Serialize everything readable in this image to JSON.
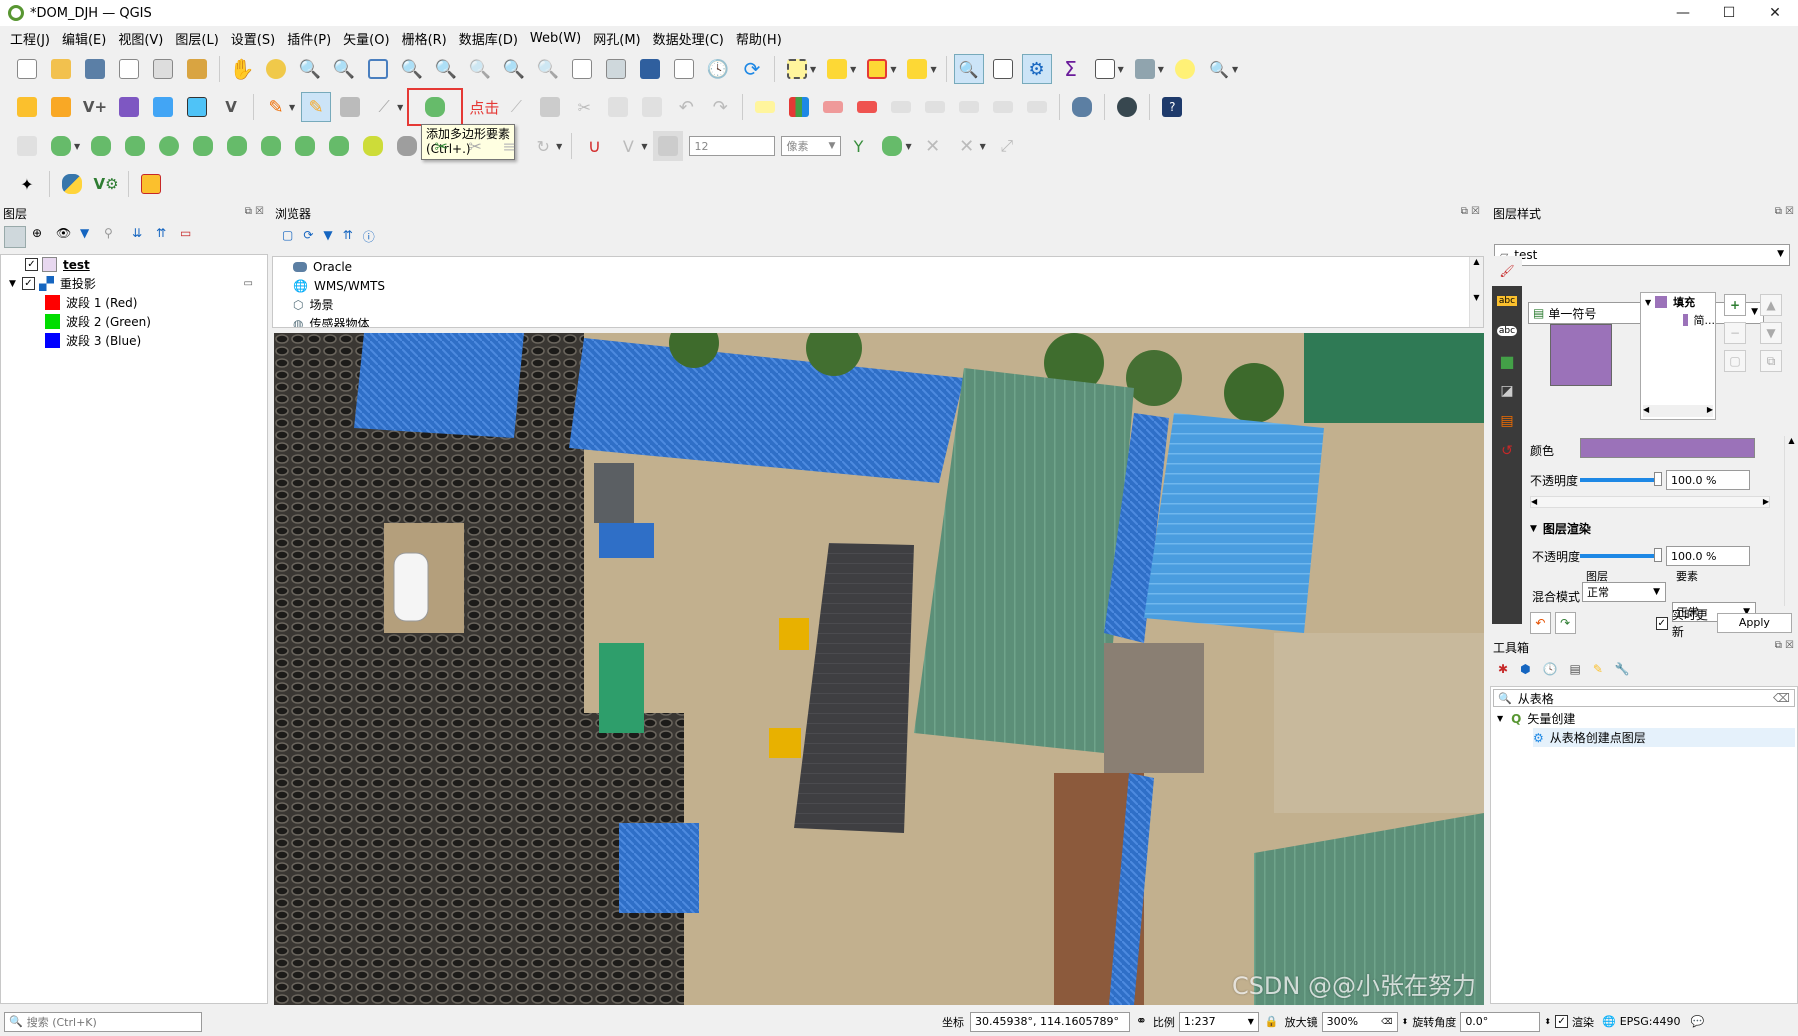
{
  "window": {
    "title": "*DOM_DJH — QGIS",
    "minimize": "—",
    "maximize": "☐",
    "close": "✕"
  },
  "menu": [
    "工程(J)",
    "编辑(E)",
    "视图(V)",
    "图层(L)",
    "设置(S)",
    "插件(P)",
    "矢量(O)",
    "栅格(R)",
    "数据库(D)",
    "Web(W)",
    "网孔(M)",
    "数据处理(C)",
    "帮助(H)"
  ],
  "digitize": {
    "click_annotation": "点击",
    "tooltip_line1": "添加多边形要素",
    "tooltip_line2": "(Ctrl+.)",
    "snap_tolerance": "12",
    "snap_unit": "像素"
  },
  "layers_panel": {
    "title": "图层",
    "layers": [
      {
        "name": "test",
        "checked": true,
        "bold": true
      },
      {
        "name": "重投影",
        "checked": true,
        "bold": false
      }
    ],
    "bands": [
      {
        "name": "波段 1 (Red)",
        "color": "#ff0000"
      },
      {
        "name": "波段 2 (Green)",
        "color": "#00dd00"
      },
      {
        "name": "波段 3 (Blue)",
        "color": "#0000ff"
      }
    ]
  },
  "browser_panel": {
    "title": "浏览器",
    "items": [
      "Oracle",
      "WMS/WMTS",
      "场景",
      "传感器物体"
    ]
  },
  "style_panel": {
    "title": "图层样式",
    "layer_select": "test",
    "renderer": "单一符号",
    "symbol_tree": [
      "填充",
      "简..."
    ],
    "fill_color": "#9b72b9",
    "color_label": "颜色",
    "opacity_label": "不透明度",
    "opacity_value": "100.0 %",
    "render_section": "图层渲染",
    "render_opacity_label": "不透明度",
    "render_opacity_value": "100.0 %",
    "blend_label": "混合模式",
    "blend_layer_label": "图层",
    "blend_feature_label": "要素",
    "blend_layer_value": "正常",
    "blend_feature_value": "正常",
    "live_update_label": "实时更新",
    "apply_label": "Apply"
  },
  "toolbox_panel": {
    "title": "工具箱",
    "search_value": "从表格",
    "group": "矢量创建",
    "tool": "从表格创建点图层"
  },
  "status": {
    "search_placeholder": "搜索 (Ctrl+K)",
    "coord_label": "坐标",
    "coord_value": "30.45938°, 114.1605789°",
    "scale_label": "比例",
    "scale_value": "1:237",
    "magnifier_label": "放大镜",
    "magnifier_value": "300%",
    "rotation_label": "旋转角度",
    "rotation_value": "0.0°",
    "render_label": "渲染",
    "crs": "EPSG:4490"
  },
  "watermark": "CSDN @@小张在努力"
}
